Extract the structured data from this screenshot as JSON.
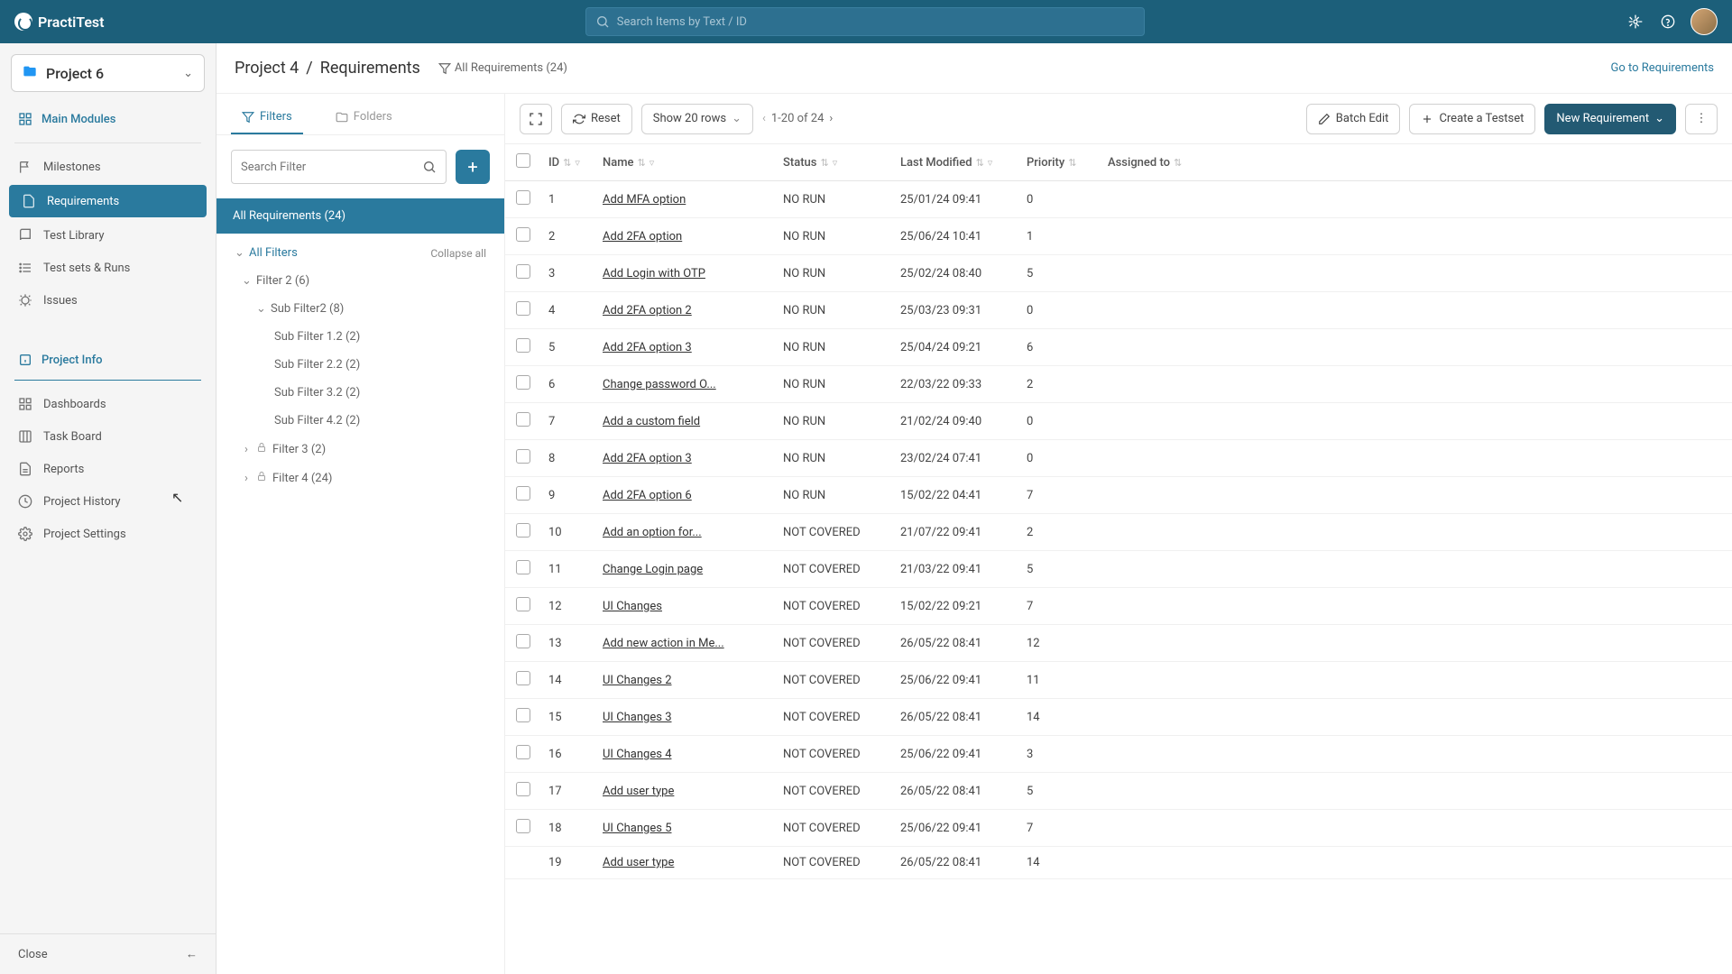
{
  "header": {
    "logo_text": "PractiTest",
    "search_placeholder": "Search Items by Text / ID"
  },
  "sidebar": {
    "project_name": "Project 6",
    "main_modules_label": "Main Modules",
    "nav_main": [
      {
        "label": "Milestones",
        "icon": "flag"
      },
      {
        "label": "Requirements",
        "icon": "doc",
        "active": true
      },
      {
        "label": "Test Library",
        "icon": "book"
      },
      {
        "label": "Test sets & Runs",
        "icon": "list"
      },
      {
        "label": "Issues",
        "icon": "bug"
      }
    ],
    "project_info_label": "Project Info",
    "nav_info": [
      {
        "label": "Dashboards",
        "icon": "grid"
      },
      {
        "label": "Task Board",
        "icon": "board"
      },
      {
        "label": "Reports",
        "icon": "report"
      },
      {
        "label": "Project History",
        "icon": "clock"
      },
      {
        "label": "Project Settings",
        "icon": "gear"
      }
    ],
    "close_label": "Close"
  },
  "breadcrumb": {
    "project": "Project 4",
    "section": "Requirements",
    "filter_label": "All Requirements (24)",
    "go_link": "Go to Requirements"
  },
  "filter_panel": {
    "tab_filters": "Filters",
    "tab_folders": "Folders",
    "search_placeholder": "Search Filter",
    "selected_filter": "All Requirements (24)",
    "all_filters_label": "All Filters",
    "collapse_label": "Collapse all",
    "tree": [
      {
        "label": "Filter 2 (6)",
        "depth": 1,
        "expanded": true
      },
      {
        "label": "Sub Filter2 (8)",
        "depth": 2,
        "expanded": true
      },
      {
        "label": "Sub Filter 1.2 (2)",
        "depth": 3
      },
      {
        "label": "Sub Filter 2.2 (2)",
        "depth": 3
      },
      {
        "label": "Sub Filter 3.2 (2)",
        "depth": 3
      },
      {
        "label": "Sub Filter 4.2 (2)",
        "depth": 3
      },
      {
        "label": "Filter 3 (2)",
        "depth": 1,
        "expanded": false,
        "private": true
      },
      {
        "label": "Filter 4 (24)",
        "depth": 1,
        "expanded": false,
        "private": true
      }
    ]
  },
  "toolbar": {
    "reset": "Reset",
    "show_rows": "Show 20 rows",
    "pagination": "1-20 of 24",
    "batch_edit": "Batch Edit",
    "create_testset": "Create a Testset",
    "new_requirement": "New Requirement"
  },
  "table": {
    "columns": [
      "",
      "ID",
      "Name",
      "Status",
      "Last Modified",
      "Priority",
      "Assigned to"
    ],
    "rows": [
      {
        "id": "1",
        "name": "Add MFA option",
        "status": "NO RUN",
        "modified": "25/01/24 09:41",
        "priority": "0",
        "assigned": ""
      },
      {
        "id": "2",
        "name": "Add 2FA option",
        "status": "NO RUN",
        "modified": "25/06/24 10:41",
        "priority": "1",
        "assigned": ""
      },
      {
        "id": "3",
        "name": "Add Login with OTP",
        "status": "NO RUN",
        "modified": "25/02/24 08:40",
        "priority": "5",
        "assigned": ""
      },
      {
        "id": "4",
        "name": "Add 2FA option 2",
        "status": "NO RUN",
        "modified": "25/03/23 09:31",
        "priority": "0",
        "assigned": ""
      },
      {
        "id": "5",
        "name": "Add 2FA option 3",
        "status": "NO RUN",
        "modified": "25/04/24 09:21",
        "priority": "6",
        "assigned": ""
      },
      {
        "id": "6",
        "name": "Change password O...",
        "status": "NO RUN",
        "modified": "22/03/22 09:33",
        "priority": "2",
        "assigned": ""
      },
      {
        "id": "7",
        "name": "Add a custom field",
        "status": "NO RUN",
        "modified": "21/02/24 09:40",
        "priority": "0",
        "assigned": ""
      },
      {
        "id": "8",
        "name": "Add 2FA option 3",
        "status": "NO RUN",
        "modified": "23/02/24 07:41",
        "priority": "0",
        "assigned": ""
      },
      {
        "id": "9",
        "name": "Add 2FA option 6",
        "status": "NO RUN",
        "modified": "15/02/22 04:41",
        "priority": "7",
        "assigned": ""
      },
      {
        "id": "10",
        "name": "Add an option for...",
        "status": "NOT COVERED",
        "modified": "21/07/22 09:41",
        "priority": "2",
        "assigned": ""
      },
      {
        "id": "11",
        "name": "Change Login page",
        "status": "NOT COVERED",
        "modified": "21/03/22 09:41",
        "priority": "5",
        "assigned": ""
      },
      {
        "id": "12",
        "name": "UI Changes",
        "status": "NOT COVERED",
        "modified": "15/02/22 09:21",
        "priority": "7",
        "assigned": ""
      },
      {
        "id": "13",
        "name": "Add new action in Me...",
        "status": "NOT COVERED",
        "modified": "26/05/22 08:41",
        "priority": "12",
        "assigned": ""
      },
      {
        "id": "14",
        "name": "UI Changes 2",
        "status": "NOT COVERED",
        "modified": "25/06/22 09:41",
        "priority": "11",
        "assigned": ""
      },
      {
        "id": "15",
        "name": "UI Changes 3",
        "status": "NOT COVERED",
        "modified": "26/05/22 08:41",
        "priority": "14",
        "assigned": ""
      },
      {
        "id": "16",
        "name": "UI Changes 4",
        "status": "NOT COVERED",
        "modified": "25/06/22 09:41",
        "priority": "3",
        "assigned": ""
      },
      {
        "id": "17",
        "name": "Add user type",
        "status": "NOT COVERED",
        "modified": "26/05/22 08:41",
        "priority": "5",
        "assigned": ""
      },
      {
        "id": "18",
        "name": "UI Changes 5",
        "status": "NOT COVERED",
        "modified": "25/06/22 09:41",
        "priority": "7",
        "assigned": ""
      },
      {
        "id": "19",
        "name": "Add user type",
        "status": "NOT COVERED",
        "modified": "26/05/22 08:41",
        "priority": "14",
        "assigned": ""
      }
    ]
  }
}
